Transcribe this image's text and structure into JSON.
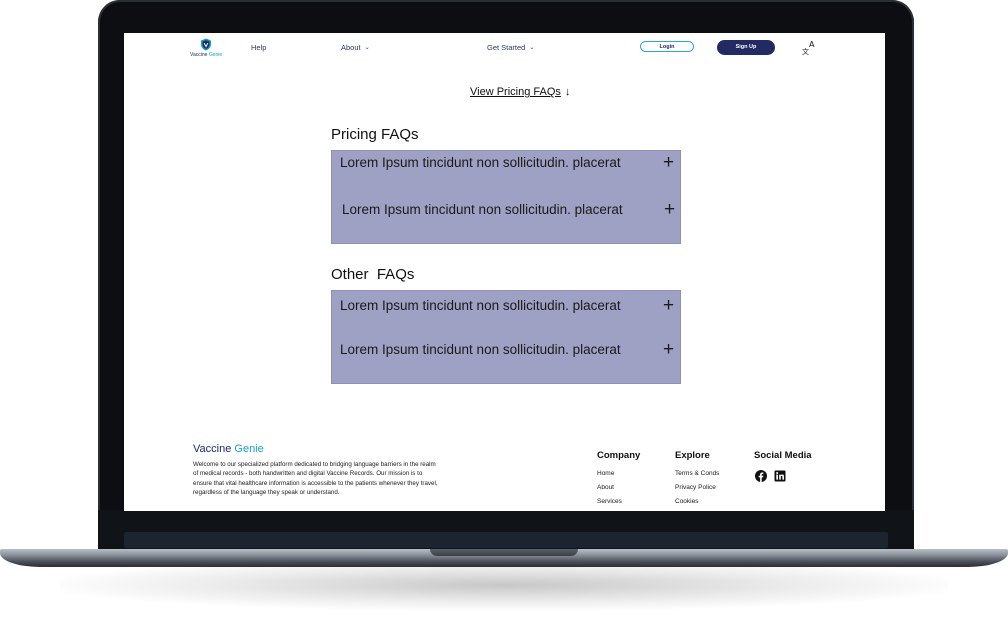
{
  "brand": {
    "name_part1": "Vaccine",
    "name_part2": "Genie",
    "colors": {
      "primary": "#222a62",
      "accent": "#17a2b8",
      "faq_background": "#9ea1c4"
    }
  },
  "nav": {
    "help": "Help",
    "about": "About",
    "get_started": "Get Started",
    "login": "Login",
    "signup": "Sign Up",
    "language_icon": "translate-icon"
  },
  "view_pricing": {
    "label": "View Pricing FAQs",
    "arrow": "↓"
  },
  "pricing_faqs": {
    "title": "Pricing FAQs",
    "items": [
      {
        "question": "Lorem Ipsum tincidunt non sollicitudin. placerat",
        "toggle": "+"
      },
      {
        "question": "Lorem Ipsum tincidunt non sollicitudin. placerat",
        "toggle": "+"
      }
    ]
  },
  "other_faqs": {
    "title": "Other  FAQs",
    "items": [
      {
        "question": "Lorem Ipsum tincidunt non sollicitudin. placerat",
        "toggle": "+"
      },
      {
        "question": "Lorem Ipsum tincidunt non sollicitudin. placerat",
        "toggle": "+"
      }
    ]
  },
  "footer": {
    "description": "Welcome to our specialized platform dedicated to bridging language barriers in the realm of medical records - both handwritten and digital Vaccine Records. Our mission is to ensure that vital healthcare information is accessible to the patients whenever they travel, regardless of the language they speak or understand.",
    "company": {
      "title": "Company",
      "items": [
        "Home",
        "About",
        "Services"
      ]
    },
    "explore": {
      "title": "Explore",
      "items": [
        "Terms & Conds",
        "Privacy Police",
        "Cookies"
      ]
    },
    "social": {
      "title": "Social Media",
      "icons": [
        "facebook-icon",
        "linkedin-icon"
      ]
    }
  }
}
